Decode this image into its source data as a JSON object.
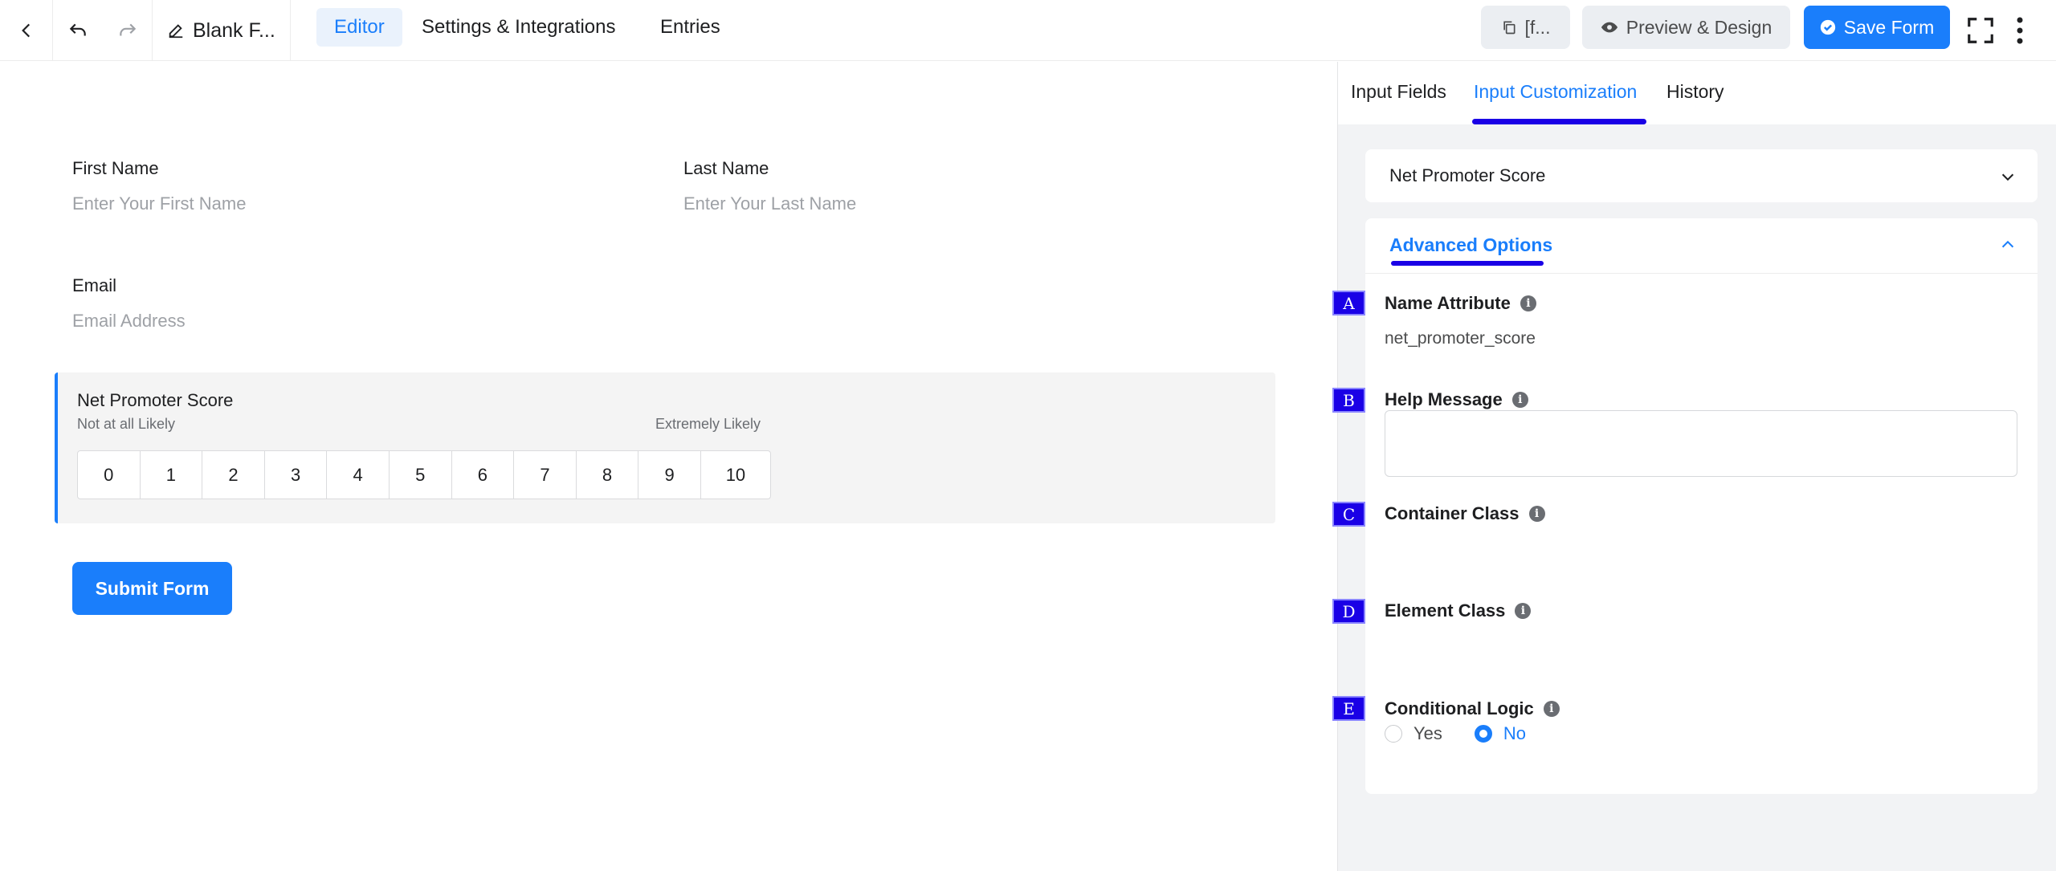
{
  "topbar": {
    "form_title": "Blank F...",
    "tabs": [
      {
        "label": "Editor",
        "active": true
      },
      {
        "label": "Settings & Integrations",
        "active": false
      },
      {
        "label": "Entries",
        "active": false
      }
    ],
    "shortcode_label": "[f...",
    "preview_label": "Preview & Design",
    "save_label": "Save Form",
    "accent_color": "#1a7efb"
  },
  "form": {
    "first_name": {
      "label": "First Name",
      "placeholder": "Enter Your First Name"
    },
    "last_name": {
      "label": "Last Name",
      "placeholder": "Enter Your Last Name"
    },
    "email": {
      "label": "Email",
      "placeholder": "Email Address"
    },
    "nps": {
      "label": "Net Promoter Score",
      "low_label": "Not at all Likely",
      "high_label": "Extremely Likely",
      "scale": [
        "0",
        "1",
        "2",
        "3",
        "4",
        "5",
        "6",
        "7",
        "8",
        "9",
        "10"
      ]
    },
    "submit_label": "Submit Form"
  },
  "panel": {
    "tabs": [
      {
        "label": "Input Fields",
        "active": false
      },
      {
        "label": "Input Customization",
        "active": true
      },
      {
        "label": "History",
        "active": false
      }
    ],
    "field_type": "Net Promoter Score",
    "advanced_title": "Advanced Options",
    "options": {
      "name_attribute": {
        "marker": "A",
        "label": "Name Attribute",
        "value": "net_promoter_score"
      },
      "help_message": {
        "marker": "B",
        "label": "Help Message",
        "value": ""
      },
      "container_class": {
        "marker": "C",
        "label": "Container Class"
      },
      "element_class": {
        "marker": "D",
        "label": "Element Class"
      },
      "conditional_logic": {
        "marker": "E",
        "label": "Conditional Logic",
        "yes": "Yes",
        "no": "No",
        "selected": "No"
      }
    },
    "info_glyph": "i"
  }
}
